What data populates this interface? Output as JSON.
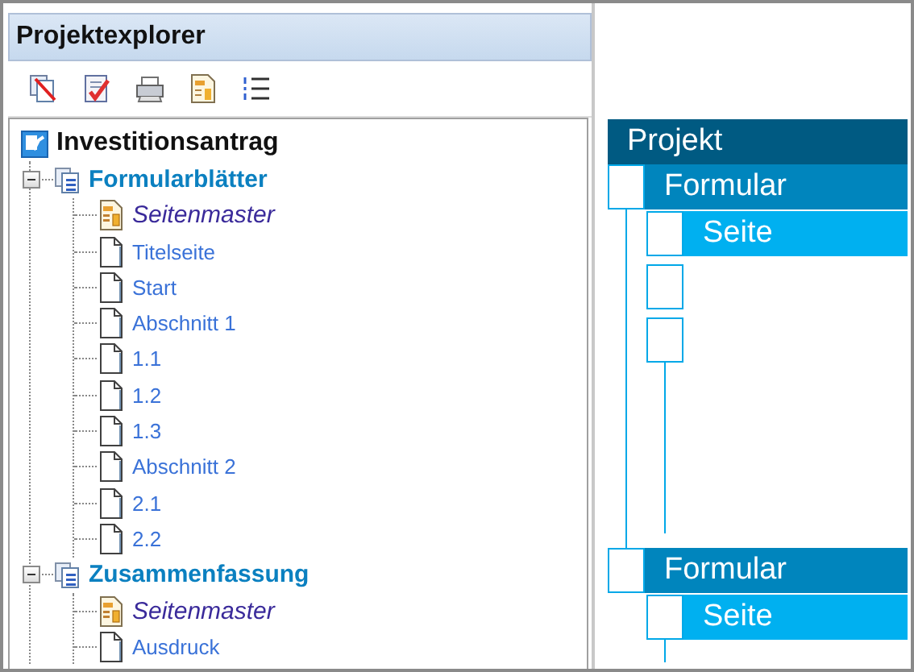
{
  "panel": {
    "title": "Projektexplorer"
  },
  "tree": [
    {
      "label": "Investitionsantrag",
      "kind": "project",
      "children": [
        {
          "label": "Formularblätter",
          "kind": "folder",
          "expanded": true,
          "children": [
            {
              "label": "Seitenmaster",
              "kind": "master"
            },
            {
              "label": "Titelseite",
              "kind": "page"
            },
            {
              "label": "Start",
              "kind": "page"
            },
            {
              "label": "Abschnitt 1",
              "kind": "page"
            },
            {
              "label": "1.1",
              "kind": "page"
            },
            {
              "label": "1.2",
              "kind": "page"
            },
            {
              "label": "1.3",
              "kind": "page"
            },
            {
              "label": "Abschnitt 2",
              "kind": "page"
            },
            {
              "label": "2.1",
              "kind": "page"
            },
            {
              "label": "2.2",
              "kind": "page"
            }
          ]
        },
        {
          "label": "Zusammenfassung",
          "kind": "folder",
          "expanded": true,
          "children": [
            {
              "label": "Seitenmaster",
              "kind": "master"
            },
            {
              "label": "Ausdruck",
              "kind": "page"
            }
          ]
        }
      ]
    }
  ],
  "diagram": {
    "label": "Projekt",
    "children": [
      {
        "label": "Formular",
        "children": [
          {
            "label": "Seite"
          },
          {
            "kind": "box"
          },
          {
            "kind": "box"
          }
        ]
      },
      {
        "label": "Formular",
        "children": [
          {
            "label": "Seite"
          }
        ]
      }
    ]
  }
}
